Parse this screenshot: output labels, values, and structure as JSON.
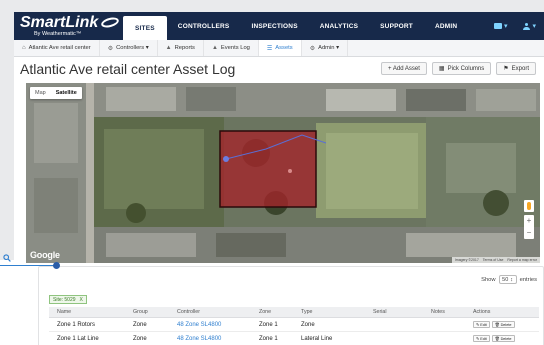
{
  "app": {
    "brand_smart": "Smart",
    "brand_link": "Link",
    "brand_sub": "By Weathermatic™"
  },
  "nav": {
    "tabs": [
      {
        "label": "SITES",
        "active": true
      },
      {
        "label": "CONTROLLERS",
        "active": false
      },
      {
        "label": "INSPECTIONS",
        "active": false
      },
      {
        "label": "ANALYTICS",
        "active": false
      },
      {
        "label": "SUPPORT",
        "active": false
      },
      {
        "label": "ADMIN",
        "active": false
      }
    ],
    "caret": "▾"
  },
  "subnav": {
    "items": [
      {
        "icon": "⌂",
        "label": "Atlantic Ave retail center"
      },
      {
        "icon": "⚙",
        "label": "Controllers ▾"
      },
      {
        "icon": "▲",
        "label": "Reports"
      },
      {
        "icon": "▲",
        "label": "Events Log"
      },
      {
        "icon": "☰",
        "label": "Assets"
      },
      {
        "icon": "⚙",
        "label": "Admin ▾"
      }
    ]
  },
  "page": {
    "title": "Atlantic Ave retail center Asset Log",
    "add_asset": "+ Add Asset",
    "pick_columns": "Pick Columns",
    "export": "Export"
  },
  "map": {
    "map_label": "Map",
    "satellite_label": "Satellite",
    "google": "Google",
    "footer_imagery": "Imagery ©2017",
    "footer_terms": "Terms of Use",
    "footer_report": "Report a map error",
    "zoom_in": "+",
    "zoom_out": "−"
  },
  "table": {
    "show_prefix": "Show",
    "show_value": "50",
    "show_suffix": "entries",
    "filter_tag": "Site: 5029",
    "filter_remove": "X",
    "headers": [
      "Name",
      "Group",
      "Controller",
      "Zone",
      "Type",
      "Serial",
      "Notes",
      "Actions"
    ],
    "edit_label": "Edit",
    "delete_label": "Delete",
    "rows": [
      {
        "name": "Zone 1 Rotors",
        "group": "Zone",
        "controller": "48 Zone SL4800",
        "zone": "Zone 1",
        "type": "Zone",
        "serial": "",
        "notes": ""
      },
      {
        "name": "Zone 1 Lat Line",
        "group": "Zone",
        "controller": "48 Zone SL4800",
        "zone": "Zone 1",
        "type": "Lateral Line",
        "serial": "",
        "notes": ""
      }
    ]
  },
  "colors": {
    "navbar": "#17294a",
    "accent": "#2f7fcf",
    "zone_overlay": "#a4242a"
  }
}
